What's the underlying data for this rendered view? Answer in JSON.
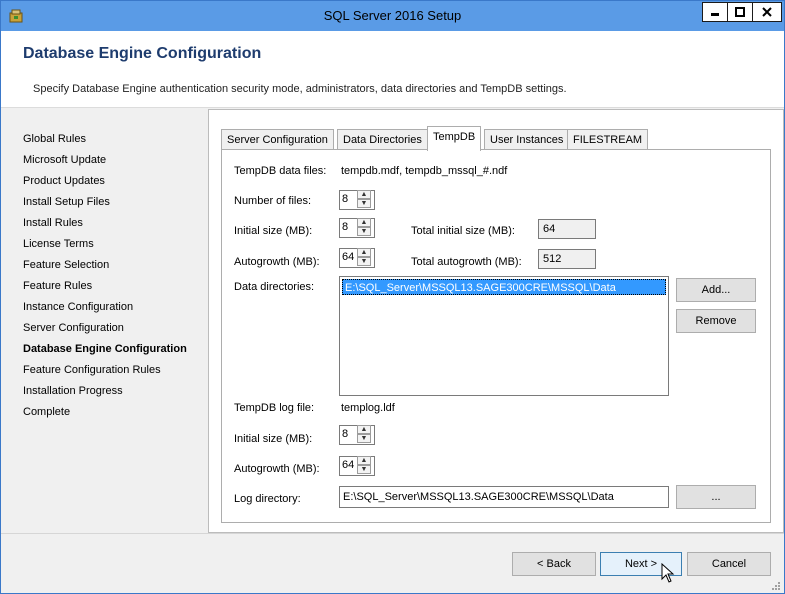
{
  "window": {
    "title": "SQL Server 2016 Setup",
    "minimize": "_",
    "maximize": "□",
    "close": "x"
  },
  "header": {
    "title": "Database Engine Configuration",
    "subtitle": "Specify Database Engine authentication security mode, administrators, data directories and TempDB settings."
  },
  "nav": {
    "items": [
      {
        "label": "Global Rules",
        "active": false
      },
      {
        "label": "Microsoft Update",
        "active": false
      },
      {
        "label": "Product Updates",
        "active": false
      },
      {
        "label": "Install Setup Files",
        "active": false
      },
      {
        "label": "Install Rules",
        "active": false
      },
      {
        "label": "License Terms",
        "active": false
      },
      {
        "label": "Feature Selection",
        "active": false
      },
      {
        "label": "Feature Rules",
        "active": false
      },
      {
        "label": "Instance Configuration",
        "active": false
      },
      {
        "label": "Server Configuration",
        "active": false
      },
      {
        "label": "Database Engine Configuration",
        "active": true
      },
      {
        "label": "Feature Configuration Rules",
        "active": false
      },
      {
        "label": "Installation Progress",
        "active": false
      },
      {
        "label": "Complete",
        "active": false
      }
    ]
  },
  "tabs": [
    {
      "label": "Server Configuration",
      "active": false
    },
    {
      "label": "Data Directories",
      "active": false
    },
    {
      "label": "TempDB",
      "active": true
    },
    {
      "label": "User Instances",
      "active": false
    },
    {
      "label": "FILESTREAM",
      "active": false
    }
  ],
  "tempdb": {
    "data_files_label": "TempDB data files:",
    "data_files_value": "tempdb.mdf, tempdb_mssql_#.ndf",
    "num_files_label": "Number of files:",
    "num_files_value": "8",
    "initial_size_label": "Initial size (MB):",
    "initial_size_value": "8",
    "total_initial_label": "Total initial size (MB):",
    "total_initial_value": "64",
    "autogrowth_label": "Autogrowth (MB):",
    "autogrowth_value": "64",
    "total_autogrowth_label": "Total autogrowth (MB):",
    "total_autogrowth_value": "512",
    "data_dirs_label": "Data directories:",
    "data_dirs": [
      "E:\\SQL_Server\\MSSQL13.SAGE300CRE\\MSSQL\\Data"
    ],
    "add_button": "Add...",
    "remove_button": "Remove",
    "log_file_label": "TempDB log file:",
    "log_file_value": "templog.ldf",
    "log_initial_label": "Initial size (MB):",
    "log_initial_value": "8",
    "log_autogrowth_label": "Autogrowth (MB):",
    "log_autogrowth_value": "64",
    "log_dir_label": "Log directory:",
    "log_dir_value": "E:\\SQL_Server\\MSSQL13.SAGE300CRE\\MSSQL\\Data",
    "browse_button": "..."
  },
  "footer": {
    "back": "< Back",
    "next": "Next >",
    "cancel": "Cancel"
  },
  "colors": {
    "titlebar": "#5a9be6",
    "header_title": "#1e3c6e",
    "selection": "#3399ff"
  }
}
